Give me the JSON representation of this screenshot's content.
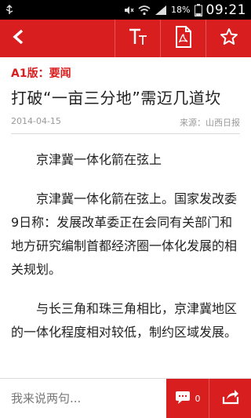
{
  "status_bar": {
    "battery_percent": "18%",
    "time": "09:21",
    "icons": [
      "usb-icon",
      "mute-icon",
      "wifi-icon",
      "signal-icon",
      "battery-icon"
    ]
  },
  "toolbar": {
    "icons": [
      "back-icon",
      "font-size-icon",
      "pdf-icon",
      "star-icon"
    ],
    "colors": {
      "toolbar_bg": "#d81e1e"
    }
  },
  "article": {
    "section": "A1版：要闻",
    "title": "打破“一亩三分地”需迈几道坎",
    "date": "2014-04-15",
    "source": "来源：山西日报",
    "paragraphs": [
      "京津冀一体化箭在弦上",
      "京津冀一体化箭在弦上。国家发改委9日称：发展改革委正在会同有关部门和地方研究编制首都经济圈一体化发展的相关规划。",
      "与长三角和珠三角相比，京津冀地区的一体化程度相对较低，制约区域发展。"
    ]
  },
  "bottom_bar": {
    "comment_placeholder": "我来说两句...",
    "comment_count": "0",
    "icons": [
      "comment-icon",
      "share-icon"
    ]
  }
}
